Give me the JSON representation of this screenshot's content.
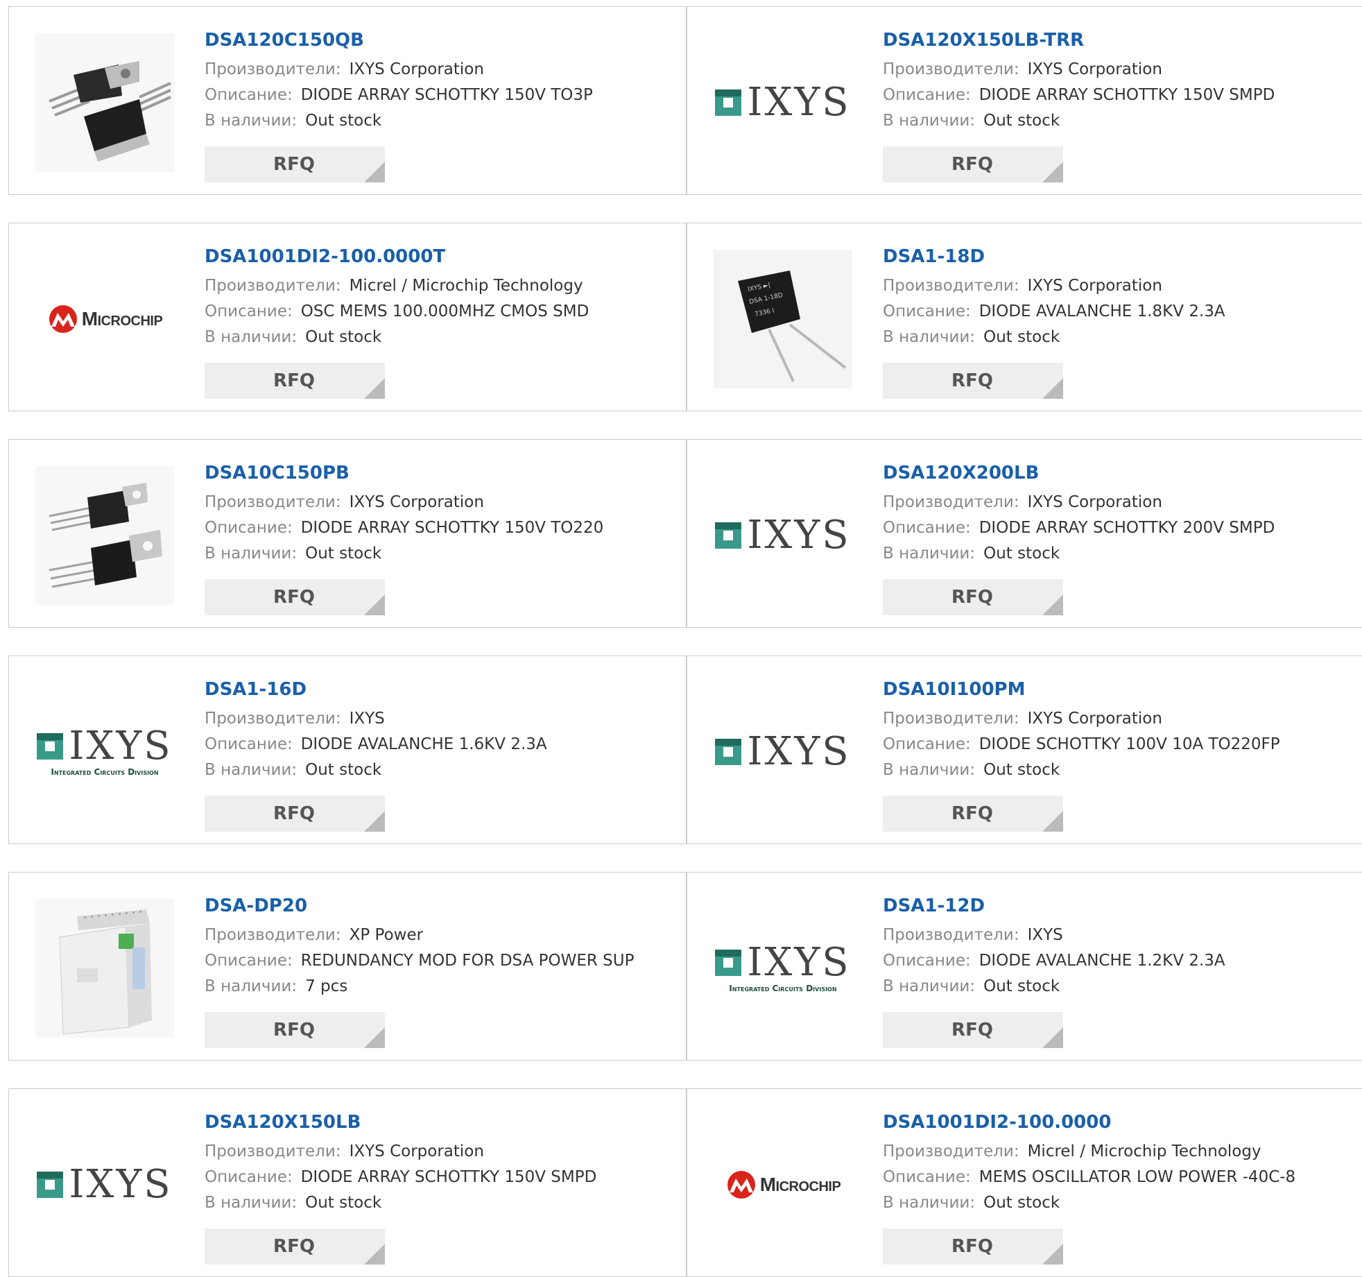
{
  "labels": {
    "manufacturer": "Производители:",
    "description": "Описание:",
    "stock": "В наличии:",
    "rfq": "RFQ"
  },
  "logo_text": {
    "ixys": "IXYS",
    "ixys_sub": "Integrated Circuits Division",
    "microchip": "Microchip"
  },
  "colors": {
    "link": "#1a5fa8",
    "label": "#888888",
    "border": "#cccccc",
    "button": "#eeeeee"
  },
  "products": [
    {
      "name": "DSA120C150QB",
      "manufacturer": "IXYS Corporation",
      "description": "DIODE ARRAY SCHOTTKY 150V TO3P",
      "stock": "Out stock",
      "image": "to3p-package-photo"
    },
    {
      "name": "DSA120X150LB-TRR",
      "manufacturer": "IXYS Corporation",
      "description": "DIODE ARRAY SCHOTTKY 150V SMPD",
      "stock": "Out stock",
      "image": "ixys-logo"
    },
    {
      "name": "DSA1001DI2-100.0000T",
      "manufacturer": "Micrel / Microchip Technology",
      "description": "OSC MEMS 100.000MHZ CMOS SMD",
      "stock": "Out stock",
      "image": "microchip-logo"
    },
    {
      "name": "DSA1-18D",
      "manufacturer": "IXYS Corporation",
      "description": "DIODE AVALANCHE 1.8KV 2.3A",
      "stock": "Out stock",
      "image": "diode-photo"
    },
    {
      "name": "DSA10C150PB",
      "manufacturer": "IXYS Corporation",
      "description": "DIODE ARRAY SCHOTTKY 150V TO220",
      "stock": "Out stock",
      "image": "to220-package-photo"
    },
    {
      "name": "DSA120X200LB",
      "manufacturer": "IXYS Corporation",
      "description": "DIODE ARRAY SCHOTTKY 200V SMPD",
      "stock": "Out stock",
      "image": "ixys-logo"
    },
    {
      "name": "DSA1-16D",
      "manufacturer": "IXYS",
      "description": "DIODE AVALANCHE 1.6KV 2.3A",
      "stock": "Out stock",
      "image": "ixys-icd-logo"
    },
    {
      "name": "DSA10I100PM",
      "manufacturer": "IXYS Corporation",
      "description": "DIODE SCHOTTKY 100V 10A TO220FP",
      "stock": "Out stock",
      "image": "ixys-logo"
    },
    {
      "name": "DSA-DP20",
      "manufacturer": "XP Power",
      "description": "REDUNDANCY MOD FOR DSA POWER SUP",
      "stock": "7 pcs",
      "image": "power-module-photo"
    },
    {
      "name": "DSA1-12D",
      "manufacturer": "IXYS",
      "description": "DIODE AVALANCHE 1.2KV 2.3A",
      "stock": "Out stock",
      "image": "ixys-icd-logo"
    },
    {
      "name": "DSA120X150LB",
      "manufacturer": "IXYS Corporation",
      "description": "DIODE ARRAY SCHOTTKY 150V SMPD",
      "stock": "Out stock",
      "image": "ixys-logo"
    },
    {
      "name": "DSA1001DI2-100.0000",
      "manufacturer": "Micrel / Microchip Technology",
      "description": "MEMS OSCILLATOR LOW POWER -40C-8",
      "stock": "Out stock",
      "image": "microchip-logo"
    }
  ]
}
